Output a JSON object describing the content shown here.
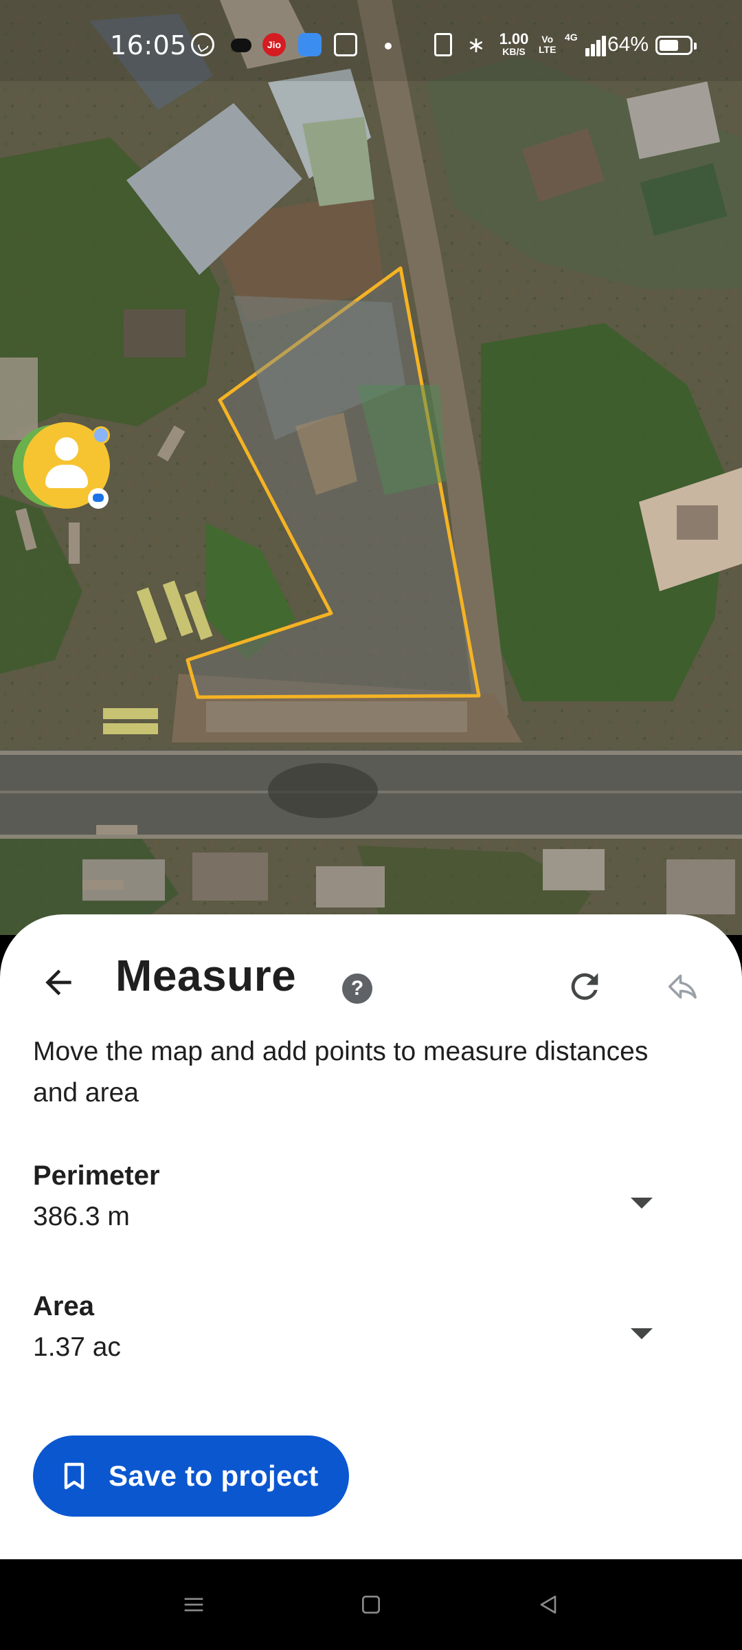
{
  "status_bar": {
    "time": "16:05",
    "jio": "Jio",
    "speed_value": "1.00",
    "speed_unit": "KB/S",
    "volte_top": "Vo",
    "volte_bottom": "LTE",
    "network": "4G",
    "battery_pct": "64%",
    "battery_level": 0.64
  },
  "map": {
    "shape_color": "#f5b324"
  },
  "sheet": {
    "title": "Measure",
    "help": "?",
    "instructions": "Move the map and add points to measure distances and area",
    "perimeter": {
      "label": "Perimeter",
      "value": "386.3 m"
    },
    "area": {
      "label": "Area",
      "value": "1.37 ac"
    },
    "save_label": "Save to project",
    "accent": "#0b57d0"
  },
  "icons": {
    "back": "back-arrow-icon",
    "help": "help-circle-icon",
    "redo": "redo-icon",
    "undo": "undo-icon",
    "dropdown": "chevron-down-icon",
    "save": "bookmark-icon",
    "nav_menu": "menu-icon",
    "nav_home": "home-square-icon",
    "nav_back": "back-triangle-icon"
  }
}
